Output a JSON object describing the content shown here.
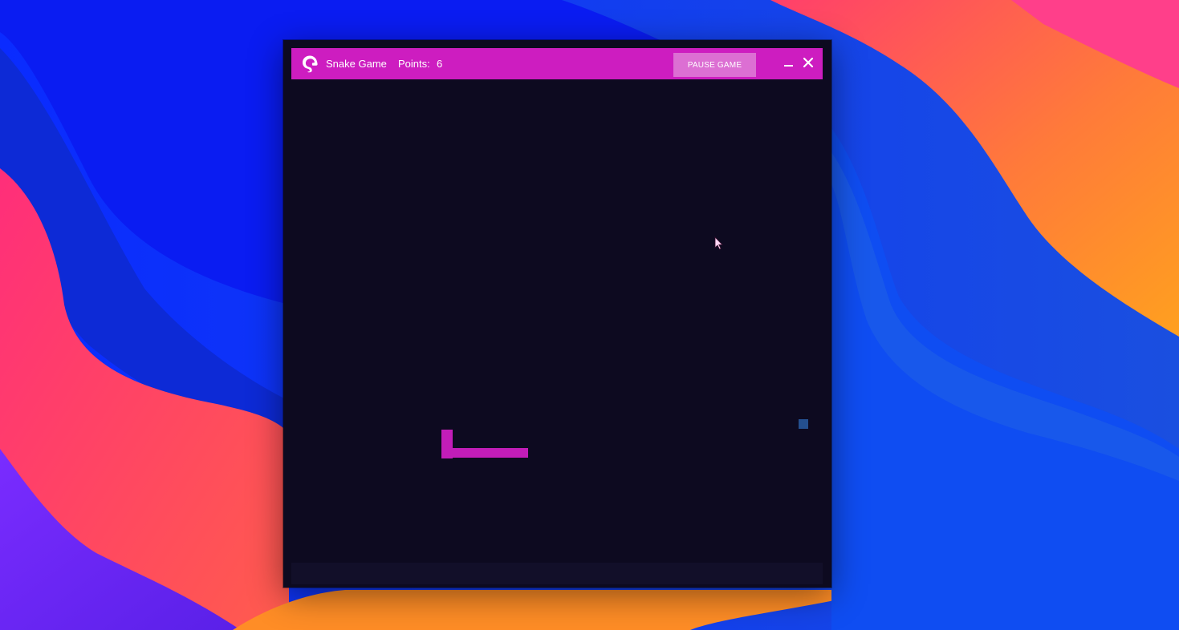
{
  "window": {
    "title": "Snake Game",
    "points_label": "Points:",
    "points_value": "6",
    "pause_button_label": "PAUSE GAME",
    "minimize_icon": "minimize-icon",
    "close_icon": "close-icon",
    "logo_icon": "snake-logo-icon"
  },
  "game": {
    "snake_color": "#c21db8",
    "food_color": "#244f8e",
    "board_color": "#0d0a20",
    "titlebar_color": "#cd1dc0"
  }
}
